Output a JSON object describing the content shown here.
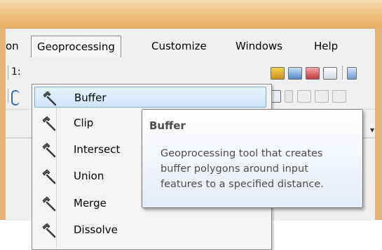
{
  "menubar": {
    "items": [
      {
        "label": "on"
      },
      {
        "label": "Geoprocessing"
      },
      {
        "label": "Customize"
      },
      {
        "label": "Windows"
      },
      {
        "label": "Help"
      }
    ]
  },
  "toolbar": {
    "scale_prefix": "1:"
  },
  "dropdown": {
    "items": [
      {
        "label": "Buffer",
        "icon": "hammer-icon",
        "selected": true
      },
      {
        "label": "Clip",
        "icon": "hammer-icon"
      },
      {
        "label": "Intersect",
        "icon": "hammer-icon"
      },
      {
        "label": "Union",
        "icon": "hammer-icon"
      },
      {
        "label": "Merge",
        "icon": "hammer-icon"
      },
      {
        "label": "Dissolve",
        "icon": "hammer-icon"
      }
    ]
  },
  "tooltip": {
    "title": "Buffer",
    "lines": [
      "Geoprocessing tool that creates",
      "buffer polygons around input",
      "features to a specified distance."
    ]
  },
  "colors": {
    "title_bar": "#efbf7e",
    "selection_border": "#7cabe0",
    "selection_fill": "#cfe5fb"
  }
}
